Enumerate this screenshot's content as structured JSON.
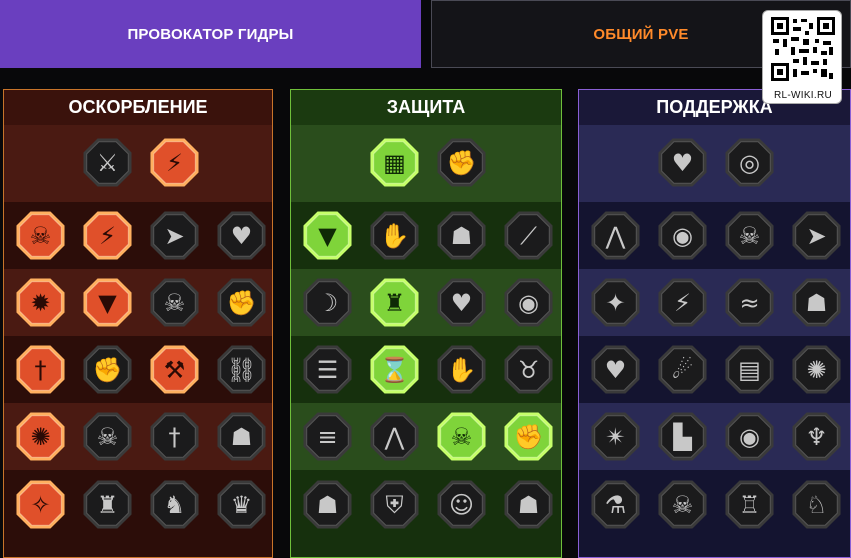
{
  "tabs": [
    {
      "label": "ПРОВОКАТОР ГИДРЫ",
      "active": true
    },
    {
      "label": "ОБЩИЙ PVE",
      "active": false
    }
  ],
  "watermark": {
    "text": "RL-WIKI.RU"
  },
  "panels": [
    {
      "id": "offense",
      "title": "ОСКОРБЛЕНИЕ",
      "colors": {
        "border": "#c8742a",
        "header": "#3a120c",
        "row_dark": "#2c0d09",
        "row_light": "#4a1a12",
        "active_fill": "#e0502a",
        "active_ring": "#ffb060"
      },
      "rows": [
        [
          {
            "icon": "crossed-swords-icon",
            "active": false
          },
          {
            "icon": "slash-strike-icon",
            "active": true
          }
        ],
        [
          {
            "icon": "horned-demon-icon",
            "active": true
          },
          {
            "icon": "claw-strike-icon",
            "active": true
          },
          {
            "icon": "shield-arrow-icon",
            "active": false
          },
          {
            "icon": "heart-pierce-icon",
            "active": false
          }
        ],
        [
          {
            "icon": "hit-impact-icon",
            "active": true
          },
          {
            "icon": "fangs-icon",
            "active": true
          },
          {
            "icon": "skull-slash-icon",
            "active": false
          },
          {
            "icon": "fist-strike-icon",
            "active": false
          }
        ],
        [
          {
            "icon": "sword-target-icon",
            "active": true
          },
          {
            "icon": "raised-fist-icon",
            "active": false
          },
          {
            "icon": "axe-icon",
            "active": true
          },
          {
            "icon": "chains-icon",
            "active": false
          }
        ],
        [
          {
            "icon": "explosion-icon",
            "active": true
          },
          {
            "icon": "skulls-icon",
            "active": false
          },
          {
            "icon": "dagger-sun-icon",
            "active": false
          },
          {
            "icon": "warrior-icon",
            "active": false
          }
        ],
        [
          {
            "icon": "sparkle-sword-icon",
            "active": true
          },
          {
            "icon": "knight-helmet-icon",
            "active": false
          },
          {
            "icon": "beast-icon",
            "active": false
          },
          {
            "icon": "spiked-helmet-icon",
            "active": false
          }
        ]
      ]
    },
    {
      "id": "defense",
      "title": "ЗАЩИТА",
      "colors": {
        "border": "#6fbf3a",
        "header": "#1b3a10",
        "row_dark": "#16300d",
        "row_light": "#2a4d1c",
        "active_fill": "#7fd43a",
        "active_ring": "#c6ff6a"
      },
      "rows": [
        [
          {
            "icon": "wall-icon",
            "active": true
          },
          {
            "icon": "fist-icon",
            "active": false
          }
        ],
        [
          {
            "icon": "chevron-shield-icon",
            "active": true
          },
          {
            "icon": "hand-shield-icon",
            "active": false
          },
          {
            "icon": "strongman-icon",
            "active": false
          },
          {
            "icon": "blade-deflect-icon",
            "active": false
          }
        ],
        [
          {
            "icon": "spirit-icon",
            "active": false
          },
          {
            "icon": "knight-shield-icon",
            "active": true
          },
          {
            "icon": "heart-skull-icon",
            "active": false
          },
          {
            "icon": "aura-head-icon",
            "active": false
          }
        ],
        [
          {
            "icon": "crowd-icon",
            "active": false
          },
          {
            "icon": "hourglass-icon",
            "active": true
          },
          {
            "icon": "open-hand-icon",
            "active": false
          },
          {
            "icon": "bull-icon",
            "active": false
          }
        ],
        [
          {
            "icon": "dash-icon",
            "active": false
          },
          {
            "icon": "claws-icon",
            "active": false
          },
          {
            "icon": "radiant-skull-icon",
            "active": true
          },
          {
            "icon": "hand-grab-icon",
            "active": true
          }
        ],
        [
          {
            "icon": "golem-icon",
            "active": false
          },
          {
            "icon": "armor-icon",
            "active": false
          },
          {
            "icon": "dwarf-icon",
            "active": false
          },
          {
            "icon": "muscle-icon",
            "active": false
          }
        ]
      ]
    },
    {
      "id": "support",
      "title": "ПОДДЕРЖКА",
      "colors": {
        "border": "#8a5fd6",
        "header": "#1a1838",
        "row_dark": "#141430",
        "row_light": "#2a2a55",
        "active_fill": "#6a5ac0",
        "active_ring": "#a89aff"
      },
      "rows": [
        [
          {
            "icon": "healing-heart-icon",
            "active": false
          },
          {
            "icon": "vortex-icon",
            "active": false
          }
        ],
        [
          {
            "icon": "praying-hands-icon",
            "active": false
          },
          {
            "icon": "shield-ring-icon",
            "active": false
          },
          {
            "icon": "skull-flask-icon",
            "active": false
          },
          {
            "icon": "speed-arrow-icon",
            "active": false
          }
        ],
        [
          {
            "icon": "blessing-icon",
            "active": false
          },
          {
            "icon": "lightning-shield-icon",
            "active": false
          },
          {
            "icon": "crack-icon",
            "active": false
          },
          {
            "icon": "silhouette-icon",
            "active": false
          }
        ],
        [
          {
            "icon": "heart-chain-icon",
            "active": false
          },
          {
            "icon": "meteor-icon",
            "active": false
          },
          {
            "icon": "open-book-icon",
            "active": false
          },
          {
            "icon": "sunburst-icon",
            "active": false
          }
        ],
        [
          {
            "icon": "compass-star-icon",
            "active": false
          },
          {
            "icon": "boot-icon",
            "active": false
          },
          {
            "icon": "eye-icon",
            "active": false
          },
          {
            "icon": "scarecrow-icon",
            "active": false
          }
        ],
        [
          {
            "icon": "poison-flask-icon",
            "active": false
          },
          {
            "icon": "grim-skull-icon",
            "active": false
          },
          {
            "icon": "fortress-icon",
            "active": false
          },
          {
            "icon": "eagle-icon",
            "active": false
          }
        ]
      ]
    }
  ]
}
